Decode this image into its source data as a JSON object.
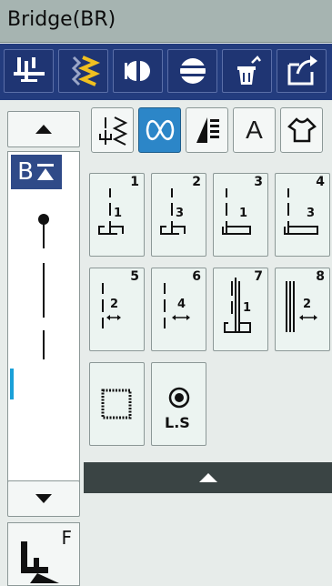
{
  "header": {
    "title": "Bridge(BR)"
  },
  "toolbar": {
    "buttons": [
      {
        "icon": "needle-threader-icon"
      },
      {
        "icon": "stitch-width-icon"
      },
      {
        "icon": "mirror-image-icon"
      },
      {
        "icon": "stitch-length-icon"
      },
      {
        "icon": "delete-icon"
      },
      {
        "icon": "memory-save-icon"
      }
    ]
  },
  "categories": [
    {
      "icon": "utility-stitch-icon",
      "active": false
    },
    {
      "icon": "decorative-stitch-icon",
      "active": true
    },
    {
      "icon": "satin-stitch-icon",
      "active": false
    },
    {
      "label": "A",
      "icon": "alphabet-icon",
      "active": false
    },
    {
      "icon": "quilt-stitch-icon",
      "active": false
    }
  ],
  "stitches": [
    {
      "num": "1",
      "sub": "1"
    },
    {
      "num": "2",
      "sub": "3"
    },
    {
      "num": "3",
      "sub": "1"
    },
    {
      "num": "4",
      "sub": "3"
    },
    {
      "num": "5",
      "sub": "2"
    },
    {
      "num": "6",
      "sub": "4"
    },
    {
      "num": "7",
      "sub": "1"
    },
    {
      "num": "8",
      "sub": "2"
    },
    {
      "label": ""
    },
    {
      "label": "L.S"
    }
  ],
  "preview": {
    "badge": "B"
  },
  "presser_foot": {
    "letter": "F"
  },
  "colors": {
    "title_bg": "#a6b4b1",
    "toolbar_bg": "#233c7e",
    "active_cat": "#2c86c8",
    "accent_yellow": "#f0c020",
    "marker": "#1aa0d8"
  }
}
